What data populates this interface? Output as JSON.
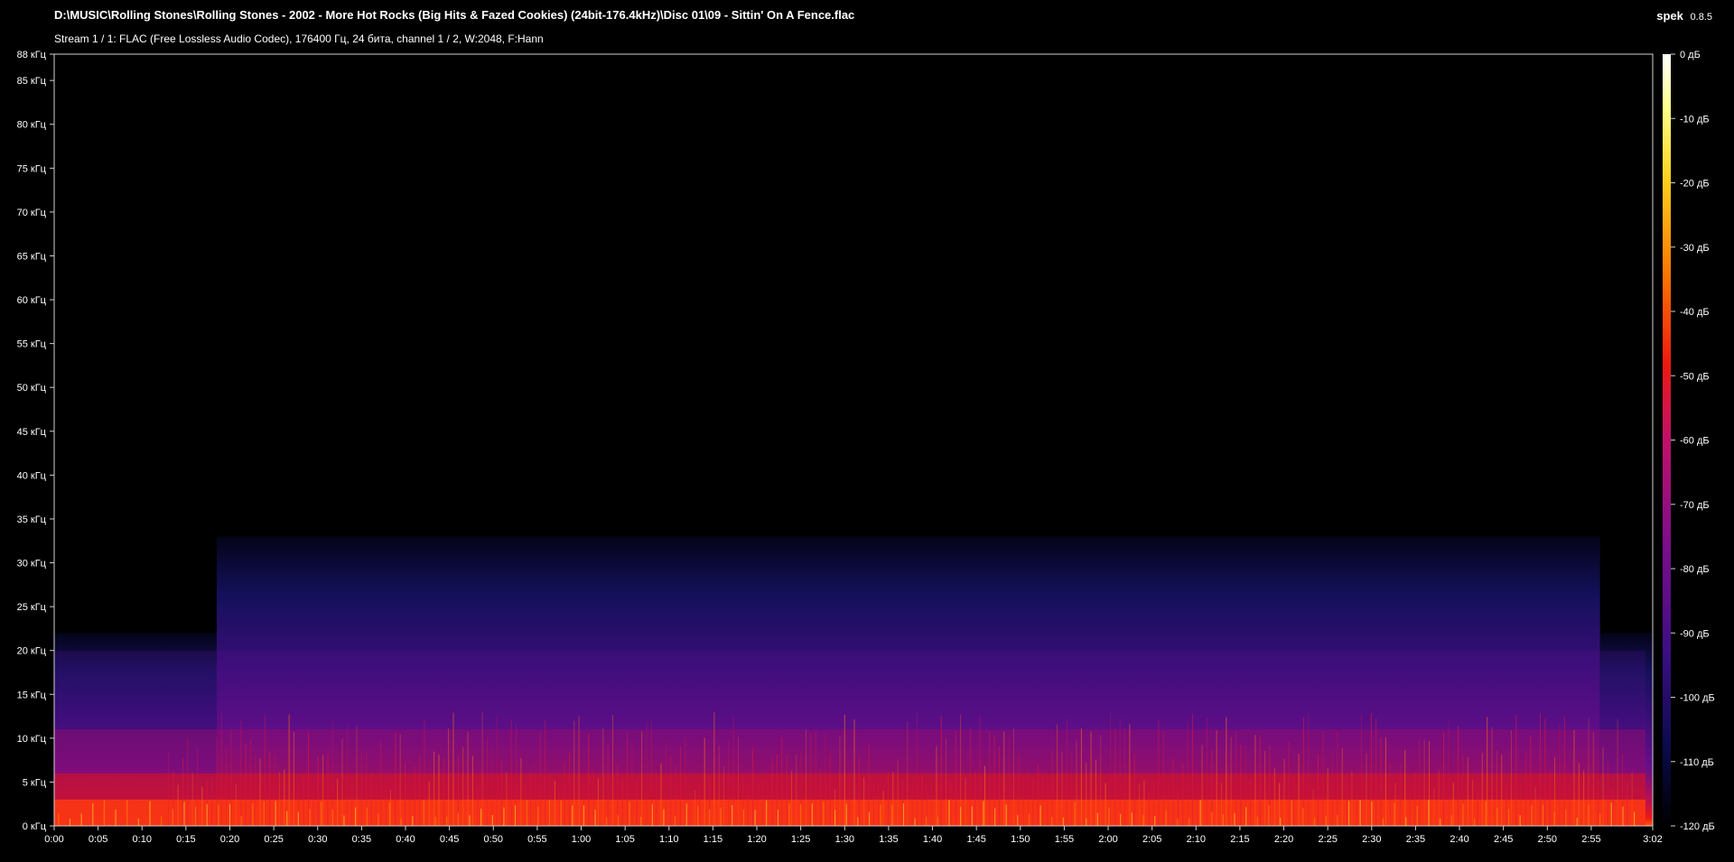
{
  "header": {
    "file_path": "D:\\MUSIC\\Rolling Stones\\Rolling Stones - 2002 - More Hot Rocks (Big Hits & Fazed Cookies) (24bit-176.4kHz)\\Disc 01\\09 - Sittin' On A Fence.flac",
    "stream_info": "Stream 1 / 1: FLAC (Free Lossless Audio Codec), 176400 Гц, 24 бита, channel 1 / 2, W:2048, F:Hann"
  },
  "brand": {
    "name": "spek",
    "version": "0.8.5"
  },
  "chart_data": {
    "type": "heatmap",
    "frequency_axis": {
      "range_khz": [
        0,
        88
      ],
      "ticks": [
        {
          "value": 0,
          "label": "0 кГц"
        },
        {
          "value": 5,
          "label": "5 кГц"
        },
        {
          "value": 10,
          "label": "10 кГц"
        },
        {
          "value": 15,
          "label": "15 кГц"
        },
        {
          "value": 20,
          "label": "20 кГц"
        },
        {
          "value": 25,
          "label": "25 кГц"
        },
        {
          "value": 30,
          "label": "30 кГц"
        },
        {
          "value": 35,
          "label": "35 кГц"
        },
        {
          "value": 40,
          "label": "40 кГц"
        },
        {
          "value": 45,
          "label": "45 кГц"
        },
        {
          "value": 50,
          "label": "50 кГц"
        },
        {
          "value": 55,
          "label": "55 кГц"
        },
        {
          "value": 60,
          "label": "60 кГц"
        },
        {
          "value": 65,
          "label": "65 кГц"
        },
        {
          "value": 70,
          "label": "70 кГц"
        },
        {
          "value": 75,
          "label": "75 кГц"
        },
        {
          "value": 80,
          "label": "80 кГц"
        },
        {
          "value": 85,
          "label": "85 кГц"
        },
        {
          "value": 88,
          "label": "88 кГц"
        }
      ]
    },
    "time_axis": {
      "range_s": [
        0,
        182
      ],
      "ticks": [
        {
          "value": 0,
          "label": "0:00"
        },
        {
          "value": 5,
          "label": "0:05"
        },
        {
          "value": 10,
          "label": "0:10"
        },
        {
          "value": 15,
          "label": "0:15"
        },
        {
          "value": 20,
          "label": "0:20"
        },
        {
          "value": 25,
          "label": "0:25"
        },
        {
          "value": 30,
          "label": "0:30"
        },
        {
          "value": 35,
          "label": "0:35"
        },
        {
          "value": 40,
          "label": "0:40"
        },
        {
          "value": 45,
          "label": "0:45"
        },
        {
          "value": 50,
          "label": "0:50"
        },
        {
          "value": 55,
          "label": "0:55"
        },
        {
          "value": 60,
          "label": "1:00"
        },
        {
          "value": 65,
          "label": "1:05"
        },
        {
          "value": 70,
          "label": "1:10"
        },
        {
          "value": 75,
          "label": "1:15"
        },
        {
          "value": 80,
          "label": "1:20"
        },
        {
          "value": 85,
          "label": "1:25"
        },
        {
          "value": 90,
          "label": "1:30"
        },
        {
          "value": 95,
          "label": "1:35"
        },
        {
          "value": 100,
          "label": "1:40"
        },
        {
          "value": 105,
          "label": "1:45"
        },
        {
          "value": 110,
          "label": "1:50"
        },
        {
          "value": 115,
          "label": "1:55"
        },
        {
          "value": 120,
          "label": "2:00"
        },
        {
          "value": 125,
          "label": "2:05"
        },
        {
          "value": 130,
          "label": "2:10"
        },
        {
          "value": 135,
          "label": "2:15"
        },
        {
          "value": 140,
          "label": "2:20"
        },
        {
          "value": 145,
          "label": "2:25"
        },
        {
          "value": 150,
          "label": "2:30"
        },
        {
          "value": 155,
          "label": "2:35"
        },
        {
          "value": 160,
          "label": "2:40"
        },
        {
          "value": 165,
          "label": "2:45"
        },
        {
          "value": 170,
          "label": "2:50"
        },
        {
          "value": 175,
          "label": "2:55"
        },
        {
          "value": 182,
          "label": "3:02"
        }
      ]
    },
    "db_scale": {
      "range_db": [
        -120,
        0
      ],
      "ticks": [
        {
          "value": 0,
          "label": "0 дБ"
        },
        {
          "value": -10,
          "label": "-10 дБ"
        },
        {
          "value": -20,
          "label": "-20 дБ"
        },
        {
          "value": -30,
          "label": "-30 дБ"
        },
        {
          "value": -40,
          "label": "-40 дБ"
        },
        {
          "value": -50,
          "label": "-50 дБ"
        },
        {
          "value": -60,
          "label": "-60 дБ"
        },
        {
          "value": -70,
          "label": "-70 дБ"
        },
        {
          "value": -80,
          "label": "-80 дБ"
        },
        {
          "value": -90,
          "label": "-90 дБ"
        },
        {
          "value": -100,
          "label": "-100 дБ"
        },
        {
          "value": -110,
          "label": "-110 дБ"
        },
        {
          "value": -120,
          "label": "-120 дБ"
        }
      ],
      "colors": [
        "#000000",
        "#0a0a4a",
        "#3a0e82",
        "#7a0e8c",
        "#c0106a",
        "#ee1a10",
        "#ff7a00",
        "#ffd21e",
        "#ffff8c",
        "#ffffff"
      ]
    },
    "spectrum_regions": [
      {
        "t_start": 0,
        "t_end": 18.5,
        "max_khz": 22,
        "level_db": -100
      },
      {
        "t_start": 18.5,
        "t_end": 176,
        "max_khz": 33,
        "level_db": -100
      },
      {
        "t_start": 176,
        "t_end": 182,
        "max_khz": 22,
        "level_db": -100
      }
    ],
    "energy_bands": [
      {
        "max_khz": 3,
        "level_db": -45
      },
      {
        "max_khz": 6,
        "level_db": -60
      },
      {
        "max_khz": 11,
        "level_db": -80
      },
      {
        "max_khz": 20,
        "level_db": -95
      }
    ]
  }
}
